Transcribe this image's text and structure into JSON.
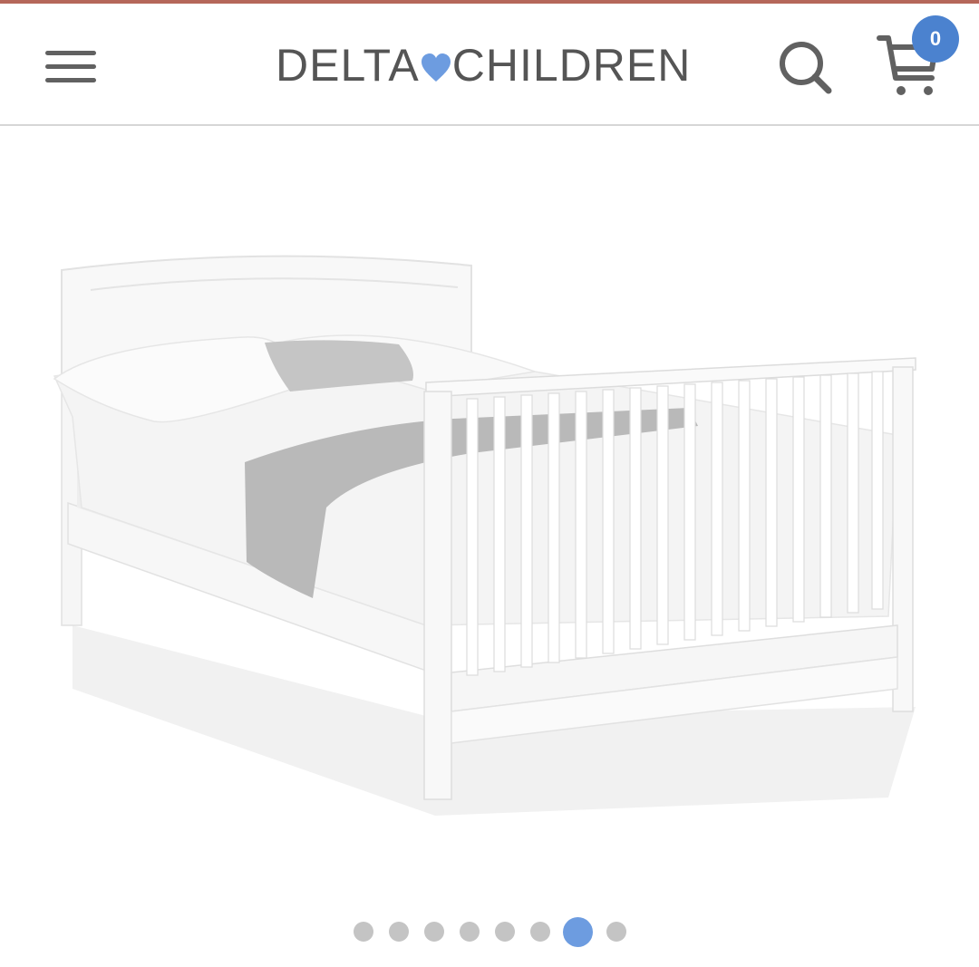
{
  "header": {
    "logo_left": "DELTA",
    "logo_right": "CHILDREN",
    "cart_count": "0"
  },
  "colors": {
    "top_strip": "#b5675a",
    "brand_heart": "#6d9ce0",
    "cart_badge": "#4b82cf",
    "icon_gray": "#616161",
    "active_dot": "#6d9ce0",
    "inactive_dot": "#c4c4c4"
  },
  "icons": {
    "menu": "hamburger-icon",
    "search": "search-icon",
    "cart": "cart-icon",
    "logo_heart": "heart-icon"
  },
  "carousel": {
    "total_slides": 8,
    "active_index": 6
  }
}
